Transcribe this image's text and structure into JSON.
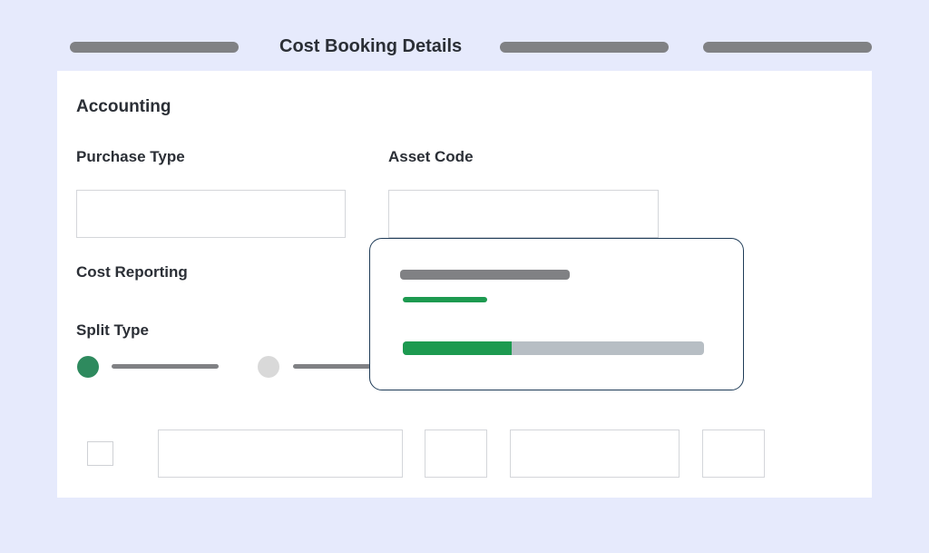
{
  "header": {
    "title": "Cost Booking Details"
  },
  "accounting": {
    "section_title": "Accounting",
    "purchase_type": {
      "label": "Purchase Type",
      "value": ""
    },
    "asset_code": {
      "label": "Asset Code",
      "value": ""
    },
    "cost_reporting": {
      "label": "Cost Reporting"
    },
    "split_type": {
      "label": "Split Type",
      "options_selected_index": 0
    }
  },
  "split_row": {
    "checkbox_checked": false,
    "fields": [
      "",
      "",
      "",
      ""
    ]
  },
  "popup": {
    "progress_fraction": 0.36
  },
  "colors": {
    "background": "#e6eafc",
    "accent_green": "#1d9a50",
    "radio_selected": "#2e8a5e",
    "radio_unselected": "#d9d9d9",
    "popup_border": "#1e3b57",
    "placeholder_gray": "#808184"
  }
}
